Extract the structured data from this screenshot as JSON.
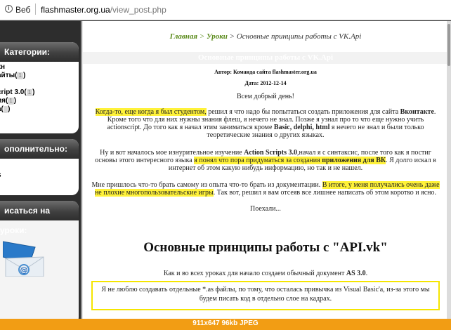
{
  "address_bar": {
    "scheme_label": "Веб",
    "domain": "flashmaster.org.ua",
    "path": "/view_post.php"
  },
  "sidebar": {
    "categories": {
      "title": "Категории:",
      "items": [
        {
          "text": "кн",
          "count": ""
        },
        {
          "text": "айты(",
          "count": "1",
          "close": ")"
        },
        {
          "text": "",
          "count": ""
        },
        {
          "text": "cript 3.0(",
          "count": "1",
          "close": ")"
        },
        {
          "text": "ия(",
          "count": "1",
          "close": ")"
        },
        {
          "text": "a(",
          "count": "",
          "close": ")"
        },
        {
          "text": ")",
          "count": ""
        }
      ]
    },
    "extra": {
      "title": "ополнительно:",
      "item": "s"
    },
    "subscribe": {
      "title": "исаться на уроки:"
    }
  },
  "post": {
    "breadcrumb": {
      "home": "Главная",
      "sep1": " > ",
      "lessons": "Уроки",
      "sep2": " > ",
      "current": "Основные принципы работы с VK.Api"
    },
    "title": "Основные принципы работы с VK.Api",
    "author": "Автор: Команда сайта flashmaster.org.ua",
    "date": "Дата: 2012-12-14",
    "greeting": "Всем добрый день!",
    "p1": {
      "highlight": "Когда-то, еще когда я был студентом,",
      "rest1": " решил я что надо бы попытаться создать приложения для сайта ",
      "bold1": "Вконтакте",
      "rest2": ". Кроме того что для них нужны знания флеш, я нечего не знал. Позже я узнал про то что еще нужно учить actionscript. До того как я начал этим заниматься кроме ",
      "bold2": "Basic, delphi, html",
      "rest3": " я нечего не знал и были только теоретические знания о других языках."
    },
    "p2": {
      "a": "Ну и вот началось мое изнурительное изучение ",
      "bold1": "Action Scripts 3.0",
      "b": ",начал я с синтаксис, после того как я постиг основы этого интересного языка ",
      "hl": "я понял что пора придуматься за создания ",
      "hl_bold": "приложения для ВК",
      "c": ". Я долго искал в интернет об этом какую нибудь информацию, но так и не нашел."
    },
    "p3": {
      "a": "Мне пришлось что-то брать самому из опыта что-то брать из документации. ",
      "hl": "В итоге, у меня получались очень даже не плохие многопользовательские игры",
      "b": ". Так вот, решил я вам отсеяв все лишнее написать об этом коротко и ясно."
    },
    "lets_go": "Поехали...",
    "heading": "Основные принципы работы с \"API.vk\"",
    "doc_line": {
      "a": "Как и во всех уроках для начало создаем обычный документ ",
      "bold": "AS 3.0",
      "b": "."
    },
    "note": "Я не люблю создавать отдельные *.as файлы, по тому, что осталась привычка из Visual Basic'a, из-за этого мы будем писать код в отдельно слое на кадрах."
  },
  "image_info": "911x647  96kb  JPEG"
}
